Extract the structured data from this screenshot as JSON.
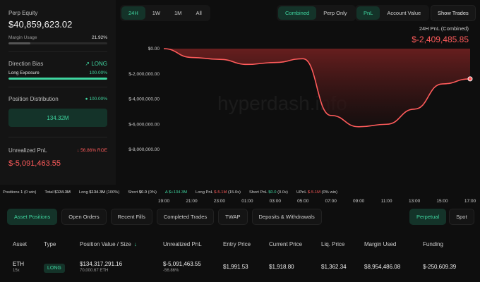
{
  "left": {
    "perp_equity_label": "Perp Equity",
    "perp_equity_value": "$40,859,623.02",
    "margin_usage_label": "Margin Usage",
    "margin_usage_value": "21.92%",
    "margin_usage_fraction": 0.2192,
    "direction_bias_label": "Direction Bias",
    "direction_bias_value": "LONG",
    "long_exposure_label": "Long Exposure",
    "long_exposure_value": "100.00%",
    "long_exposure_fraction": 1.0,
    "position_distribution_label": "Position Distribution",
    "position_distribution_percent": "100.00%",
    "position_distribution_amount": "134.32M",
    "unrealized_pnl_label": "Unrealized PnL",
    "unrealized_pnl_roe": "56.86% ROE",
    "unrealized_pnl_value": "$-5,091,463.55"
  },
  "top_tabs": [
    "24H",
    "1W",
    "1M",
    "All"
  ],
  "mode_tabs": [
    "Combined",
    "Perp Only"
  ],
  "metric_tabs": [
    "PnL",
    "Account Value"
  ],
  "show_trades_label": "Show Trades",
  "pnl_header": {
    "title": "24H PnL (Combined)",
    "value": "$-2,409,485.85"
  },
  "chart_data": {
    "type": "area",
    "x": [
      "19:00",
      "21:00",
      "23:00",
      "01:00",
      "03:00",
      "05:00",
      "07:00",
      "09:00",
      "11:00",
      "13:00",
      "15:00",
      "17:00"
    ],
    "series": [
      {
        "values": [
          0,
          -700000,
          -850000,
          -1250000,
          -1100000,
          -800000,
          -5300000,
          -6200000,
          -6000000,
          -4800000,
          -2800000,
          -2400000
        ]
      }
    ],
    "y_ticks": [
      "$0.00",
      "$-2,000,000.00",
      "$-4,000,000.00",
      "$-6,000,000.00",
      "$-8,000,000.00"
    ],
    "ylim": [
      -8000000,
      0
    ],
    "grid": false,
    "colors": {
      "line": "#ff5b5b",
      "area_top": "#6b1f1f",
      "area_bottom": "#1a0f0f"
    }
  },
  "watermark": "hyperdash.info",
  "summary": {
    "positions_label": "Positions",
    "positions_value": "1",
    "positions_win": "(0 win)",
    "total_label": "Total",
    "total_value": "$134.3M",
    "long_label": "Long",
    "long_value": "$134.3M",
    "long_pct": "(100%)",
    "short_label": "Short",
    "short_value": "$0.0",
    "short_pct": "(0%)",
    "delta_value": "Δ $+134.3M",
    "long_pnl_label": "Long PnL",
    "long_pnl_value": "$-5.1M",
    "long_pnl_ratio": "(15.0x)",
    "short_pnl_label": "Short PnL",
    "short_pnl_value": "$0.0",
    "short_pnl_ratio": "(0.0x)",
    "upnl_label": "UPnL",
    "upnl_value": "$-5.1M",
    "upnl_win": "(0% win)"
  },
  "bottom_tabs": [
    "Asset Positions",
    "Open Orders",
    "Recent Fills",
    "Completed Trades",
    "TWAP",
    "Deposits & Withdrawals"
  ],
  "market_tabs": [
    "Perpetual",
    "Spot"
  ],
  "table": {
    "headers": [
      "Asset",
      "Type",
      "Position Value / Size",
      "Unrealized PnL",
      "Entry Price",
      "Current Price",
      "Liq. Price",
      "Margin Used",
      "Funding"
    ],
    "rows": [
      {
        "asset": "ETH",
        "leverage": "15x",
        "type": "LONG",
        "position_value": "$134,317,291.16",
        "position_size": "70,000.67 ETH",
        "unrealized_pnl": "$-5,091,463.55",
        "unrealized_pnl_pct": "-56.86%",
        "entry_price": "$1,991.53",
        "current_price": "$1,918.80",
        "liq_price": "$1,362.34",
        "margin_used": "$8,954,486.08",
        "funding": "$-250,609.39"
      }
    ]
  }
}
